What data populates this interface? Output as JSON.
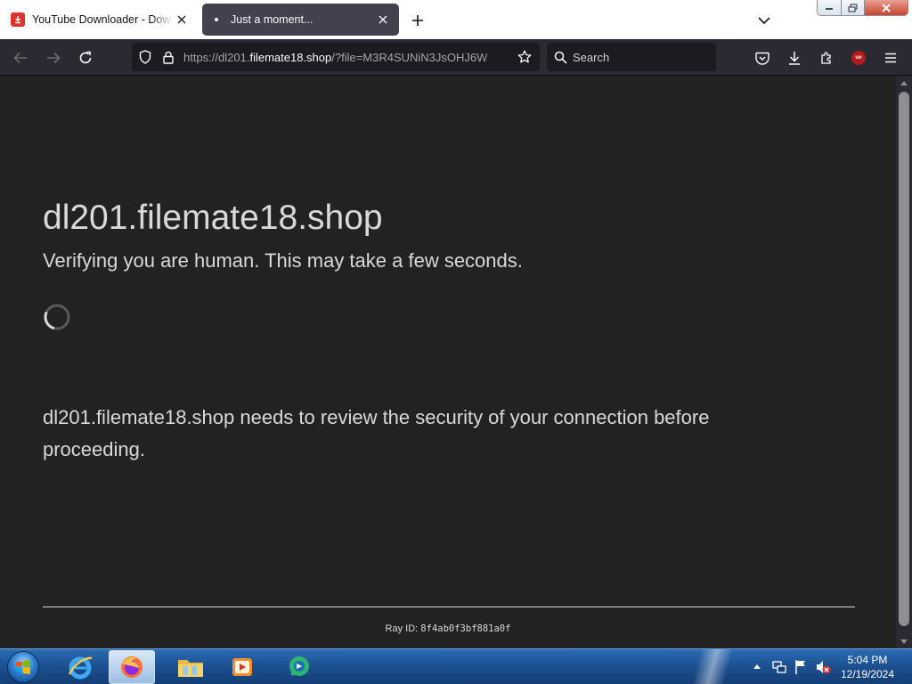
{
  "browser": {
    "tabs": [
      {
        "label": "YouTube Downloader - Download",
        "active": false
      },
      {
        "label": "Just a moment...",
        "active": true
      }
    ],
    "url": {
      "prefix": "https://dl201.",
      "host": "filemate18.shop",
      "rest": "/?file=M3R4SUNiN3JsOHJ6W"
    },
    "search_placeholder": "Search",
    "extension_badge": "uo"
  },
  "page": {
    "site_title": "dl201.filemate18.shop",
    "verifying_text": "Verifying you are human. This may take a few seconds.",
    "review_text": "dl201.filemate18.shop needs to review the security of your connection before proceeding.",
    "ray_label": "Ray ID:",
    "ray_id": "8f4ab0f3bf881a0f"
  },
  "taskbar": {
    "time": "5:04 PM",
    "date": "12/19/2024",
    "pinned_icons": [
      "internet-explorer-icon",
      "firefox-icon",
      "file-explorer-icon",
      "media-player-icon",
      "chat-app-icon"
    ]
  },
  "colors": {
    "page_bg": "#222222",
    "page_text": "#d9d9d9",
    "toolbar_bg": "#2b2a33",
    "active_tab_bg": "#42414d",
    "youtube_red": "#e0312d"
  }
}
